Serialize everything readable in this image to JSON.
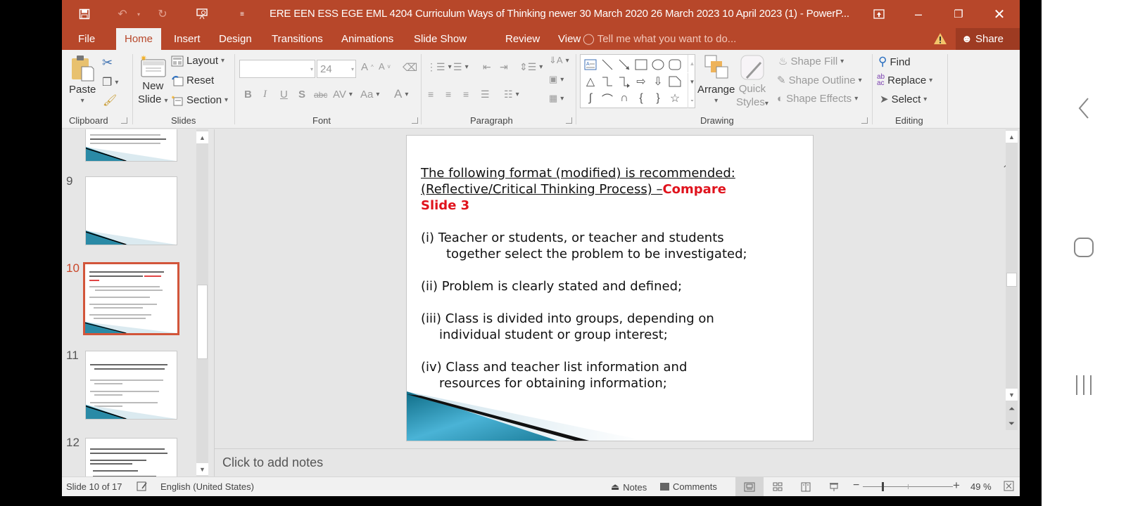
{
  "window": {
    "title": "ERE EEN ESS EGE EML 4204 Curriculum  Ways of Thinking newer  30 March 2020  26 March 2023  10 April 2023 (1) - PowerP...",
    "quick_access": [
      "save-icon",
      "undo-icon",
      "redo-icon",
      "present-from-beginning-icon",
      "customize-quick-access-icon"
    ],
    "controls": [
      "ribbon-display-options-icon",
      "minimize-icon",
      "restore-icon",
      "close-icon"
    ]
  },
  "tabs": [
    {
      "label": "File",
      "active": false
    },
    {
      "label": "Home",
      "active": true
    },
    {
      "label": "Insert",
      "active": false
    },
    {
      "label": "Design",
      "active": false
    },
    {
      "label": "Transitions",
      "active": false
    },
    {
      "label": "Animations",
      "active": false
    },
    {
      "label": "Slide Show",
      "active": false
    },
    {
      "label": "Review",
      "active": false
    },
    {
      "label": "View",
      "active": false
    }
  ],
  "tell_me": "Tell me what you want to do...",
  "share_label": "Share",
  "ribbon": {
    "clipboard": {
      "label": "Clipboard",
      "paste": "Paste"
    },
    "slides": {
      "label": "Slides",
      "new_slide_1": "New",
      "new_slide_2": "Slide",
      "layout": "Layout",
      "reset": "Reset",
      "section": "Section"
    },
    "font": {
      "label": "Font",
      "font_name": "",
      "font_size": "24",
      "bold": "B",
      "italic": "I",
      "underline": "U",
      "shadow": "S",
      "strike": "abc",
      "spacing": "AV",
      "case": "Aa",
      "color": "A",
      "grow": "A",
      "shrink": "A"
    },
    "paragraph": {
      "label": "Paragraph"
    },
    "drawing": {
      "label": "Drawing",
      "arrange": "Arrange",
      "quick_styles_1": "Quick",
      "quick_styles_2": "Styles",
      "shape_fill": "Shape Fill",
      "shape_outline": "Shape Outline",
      "shape_effects": "Shape Effects",
      "shapes": [
        "text-box",
        "line",
        "arrow-line",
        "rectangle",
        "oval",
        "rounded-rectangle",
        "triangle",
        "elbow-connector",
        "elbow-arrow-connector",
        "right-arrow",
        "down-arrow",
        "snip-rectangle",
        "freeform",
        "arc",
        "wave",
        "left-brace",
        "right-brace",
        "star"
      ]
    },
    "editing": {
      "label": "Editing",
      "find": "Find",
      "replace": "Replace",
      "select": "Select"
    }
  },
  "thumbnails": [
    {
      "number": "",
      "label": "slide-8-partial",
      "text_preview": "requires students to analyse, synthesise and evaluate information to solve problems and make decisions. [Recheck Bloom's cognitive domain.]"
    },
    {
      "number": "9",
      "label": "slide-9",
      "text_preview": ""
    },
    {
      "number": "10",
      "label": "slide-10",
      "active": true,
      "text_preview": "The following format (modified) is recommended: (Reflective/Critical Thinking Process) – Compare Slide 3"
    },
    {
      "number": "11",
      "label": "slide-11",
      "text_preview": "The following format (modified) is recommended: (Reflective/Critical Thinking Process) – Cont'd; (v) Class/groups locate/s, obtain and organize information; (vi) Class/groups analyse/s and interpret/s information; (vii) Class/groups obtain/s and test tentative conclusions"
    },
    {
      "number": "12",
      "label": "slide-12",
      "text_preview": "Questions teacher may use to stimulate Critical Thinking during a lesson (from Beyer and Brooks): (i) What do you think about this idea/object/plan etc? (ii) Why do you think that? (iii) On what is your knowledge based?"
    }
  ],
  "slide": {
    "title_line1": "The following format (modified) is recommended:",
    "title_line2": "(Reflective/Critical Thinking  Process) –",
    "title_red": "Compare",
    "title_red2": "Slide 3",
    "items": [
      {
        "line1": "(i) Teacher or students, or teacher and students",
        "line2": "together select the problem to be investigated;"
      },
      {
        "line1": "(ii) Problem is clearly stated and defined;",
        "line2": ""
      },
      {
        "line1": "(iii)  Class is divided into groups, depending on",
        "line2": "individual student or group interest;"
      },
      {
        "line1": "(iv)  Class and teacher list information and",
        "line2": "resources for obtaining information;"
      }
    ],
    "accent_color": "#e0131d"
  },
  "notes_placeholder": "Click to add notes",
  "status": {
    "slide_info": "Slide 10 of 17",
    "language": "English (United States)",
    "notes": "Notes",
    "comments": "Comments",
    "zoom": "49 %",
    "zoom_percent": 49
  },
  "colors": {
    "brand": "#b7472a",
    "active_thumb_border": "#d2553a"
  }
}
